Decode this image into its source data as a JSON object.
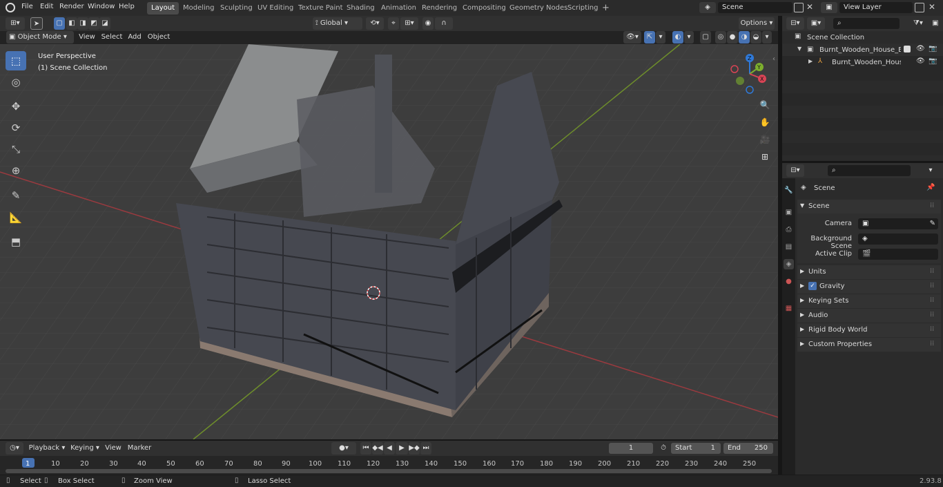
{
  "menu": [
    "File",
    "Edit",
    "Render",
    "Window",
    "Help"
  ],
  "workspaces": [
    {
      "label": "Layout",
      "active": true
    },
    {
      "label": "Modeling"
    },
    {
      "label": "Sculpting"
    },
    {
      "label": "UV Editing"
    },
    {
      "label": "Texture Paint"
    },
    {
      "label": "Shading"
    },
    {
      "label": "Animation"
    },
    {
      "label": "Rendering"
    },
    {
      "label": "Compositing"
    },
    {
      "label": "Geometry Nodes"
    },
    {
      "label": "Scripting"
    }
  ],
  "add_workspace": "+",
  "scene_field": "Scene",
  "view_layer_field": "View Layer",
  "header": {
    "mode": "Object Mode",
    "view": "View",
    "select": "Select",
    "add": "Add",
    "object": "Object",
    "transform_orientation": "Global",
    "options": "Options"
  },
  "viewport": {
    "perspective_label": "User Perspective",
    "collection_label": "(1) Scene Collection",
    "gizmo": {
      "x": "X",
      "y": "Y",
      "z": "Z"
    }
  },
  "outliner": {
    "root": "Scene Collection",
    "items": [
      {
        "label": "Burnt_Wooden_House_Brown"
      },
      {
        "label": "Burnt_Wooden_House_B"
      }
    ]
  },
  "properties": {
    "context_label": "Scene",
    "section_title": "Scene",
    "fields": [
      {
        "label": "Camera",
        "value": ""
      },
      {
        "label": "Background Scene",
        "value": ""
      },
      {
        "label": "Active Clip",
        "value": ""
      }
    ],
    "panels": [
      "Units",
      "Gravity",
      "Keying Sets",
      "Audio",
      "Rigid Body World",
      "Custom Properties"
    ]
  },
  "timeline": {
    "playback": "Playback",
    "keying": "Keying",
    "view": "View",
    "marker": "Marker",
    "current_frame": "1",
    "start_label": "Start",
    "start_value": "1",
    "end_label": "End",
    "end_value": "250",
    "ticks": [
      "1",
      "10",
      "20",
      "30",
      "40",
      "50",
      "60",
      "70",
      "80",
      "90",
      "100",
      "110",
      "120",
      "130",
      "140",
      "150",
      "160",
      "170",
      "180",
      "190",
      "200",
      "210",
      "220",
      "230",
      "240",
      "250"
    ]
  },
  "status": {
    "select": "Select",
    "box_select": "Box Select",
    "zoom_view": "Zoom View",
    "lasso_select": "Lasso Select",
    "version": "2.93.8"
  }
}
